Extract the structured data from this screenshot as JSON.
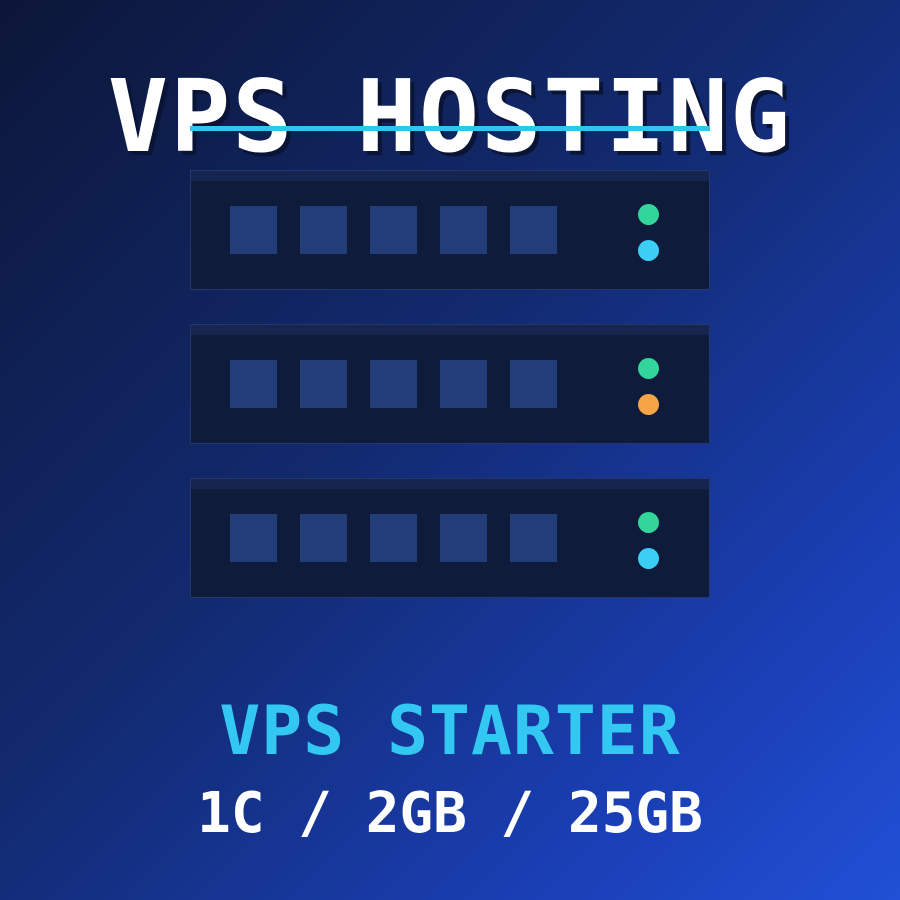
{
  "header": {
    "title": "VPS HOSTING"
  },
  "servers": [
    {
      "bays": 5,
      "led_top_color": "#33d69a",
      "led_bottom_color": "#3ccff5"
    },
    {
      "bays": 5,
      "led_top_color": "#33d69a",
      "led_bottom_color": "#f5a545"
    },
    {
      "bays": 5,
      "led_top_color": "#33d69a",
      "led_bottom_color": "#3ccff5"
    }
  ],
  "plan": {
    "name": "VPS STARTER",
    "specs": "1C / 2GB / 25GB"
  },
  "colors": {
    "background_start": "#0c1638",
    "background_end": "#2150d6",
    "accent_cyan": "#33c8f2",
    "rack": "#0f1b3a",
    "bay": "#223d78"
  },
  "icons": [
    "server-rack-icon",
    "status-led-icon"
  ]
}
